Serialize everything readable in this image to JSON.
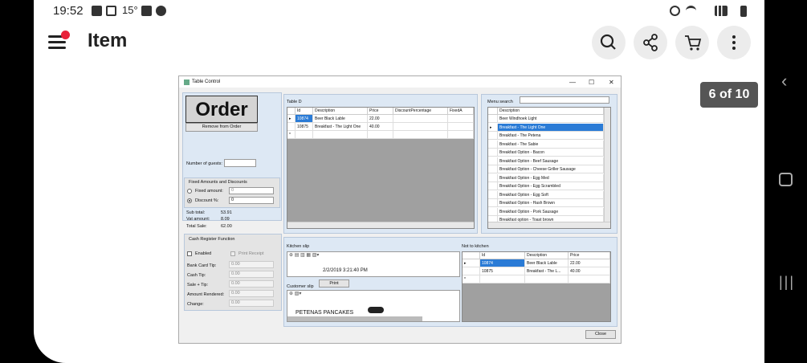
{
  "status": {
    "time": "19:52",
    "temp": "15°"
  },
  "app": {
    "title": "Item",
    "counter": "6 of 10"
  },
  "window": {
    "title": "Table Control",
    "order_heading": "Order",
    "remove_btn": "Remove from Order",
    "guests_label": "Number of guests:",
    "fixed_group": "Fixed Amounts and Discounts",
    "fixed_amount_label": "Fixed amount:",
    "fixed_amount_value": "0",
    "discount_label": "Discount %:",
    "discount_value": "0",
    "subtotal_label": "Sub total:",
    "subtotal": "53.91",
    "vat_label": "Vat amount:",
    "vat": "8.09",
    "total_label": "Total Sale:",
    "total": "62.00",
    "cash_group": "Cash Register Function",
    "enabled_label": "Enabled",
    "print_receipt_label": "Print Receipt",
    "bank_tip_label": "Bank Card Tip:",
    "cash_tip_label": "Cash Tip:",
    "sale_tip_label": "Sale + Tip:",
    "rendered_label": "Amount Rendered:",
    "change_label": "Change:",
    "zero": "0.00",
    "table_label": "Table  D",
    "order_cols": [
      "Id",
      "Description",
      "Price",
      "DiscountPercentage",
      "FixedA"
    ],
    "order_rows": [
      [
        "10874",
        "Beer Black Lable",
        "22.00"
      ],
      [
        "10875",
        "Breakfast - The Light One",
        "40.00"
      ]
    ],
    "menu_search_label": "Menu search",
    "menu_col": "Description",
    "menu_items": [
      "Beer Windhoek Light",
      "Breakfast - The Light One",
      "Breakfast - The Petena",
      "Breakfast - The Sabie",
      "Breakfast Option - Bacon",
      "Breakfast Option - Beef Sausage",
      "Breakfast Option - Cheese Griller Sausage",
      "Breakfast Option - Egg Med",
      "Breakfast Option - Egg Scrambled",
      "Breakfast Option - Egg Soft",
      "Breakfast Option - Hash Brown",
      "Breakfast Option - Pork Sausage",
      "Breakfast option - Toast brown"
    ],
    "kitchen_slip_label": "Kitchen slip",
    "kitchen_slip_text": "2/2/2019 3:21:40 PM",
    "customer_slip_label": "Customer slip",
    "print_btn": "Print",
    "customer_slip_text": "PETENAS PANCAKES",
    "not_kitchen_label": "Not to kitchen",
    "nk_cols": [
      "Id",
      "Description",
      "Price"
    ],
    "nk_rows": [
      [
        "10874",
        "Beer Black Lable",
        "22.00"
      ],
      [
        "10875",
        "Breakfast - The L...",
        "40.00"
      ]
    ],
    "close_btn": "Close"
  }
}
